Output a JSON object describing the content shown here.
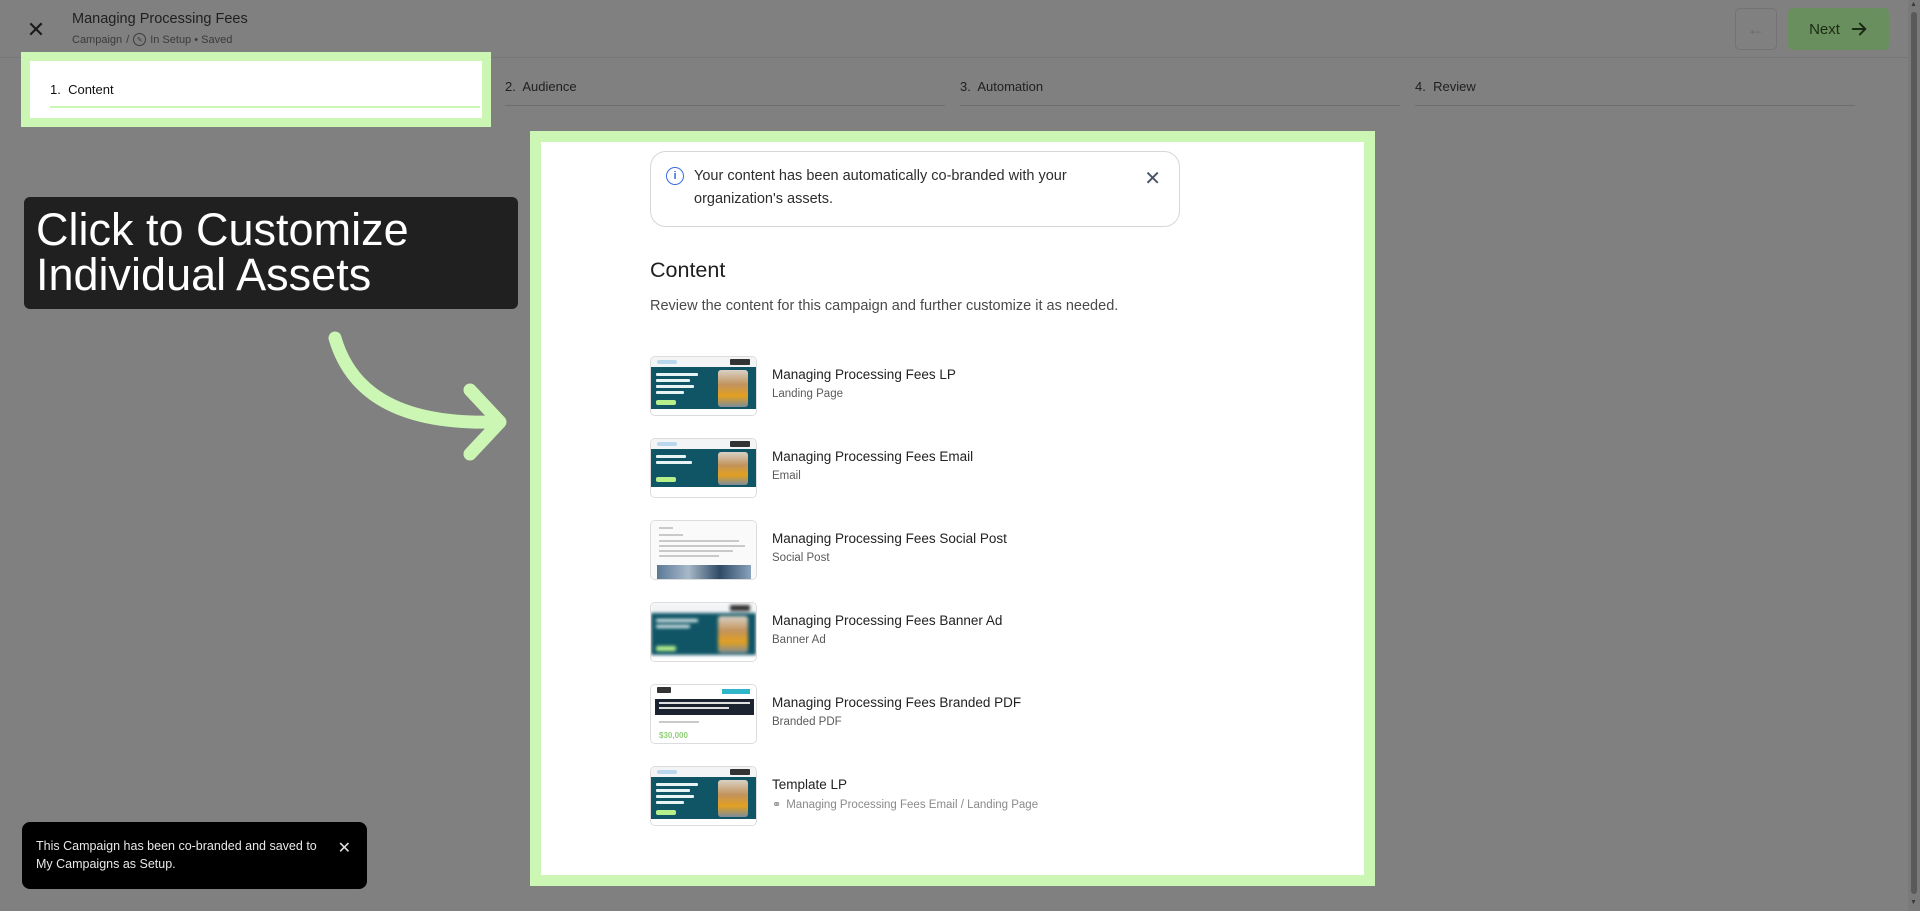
{
  "header": {
    "title": "Managing Processing Fees",
    "breadcrumb_parent": "Campaign",
    "breadcrumb_sep": "/",
    "status": "In Setup • Saved",
    "next_label": "Next"
  },
  "steps": [
    {
      "number": "1.",
      "label": "Content"
    },
    {
      "number": "2.",
      "label": "Audience"
    },
    {
      "number": "3.",
      "label": "Automation"
    },
    {
      "number": "4.",
      "label": "Review"
    }
  ],
  "callout": {
    "text": "Click to Customize\nIndividual Assets"
  },
  "info_banner": {
    "text": "Your content has been automatically co-branded with your organization's assets."
  },
  "content": {
    "heading": "Content",
    "subheading": "Review the content for this campaign and further customize it as needed."
  },
  "assets": [
    {
      "title": "Managing Processing Fees LP",
      "type": "Landing Page"
    },
    {
      "title": "Managing Processing Fees Email",
      "type": "Email"
    },
    {
      "title": "Managing Processing Fees Social Post",
      "type": "Social Post"
    },
    {
      "title": "Managing Processing Fees Banner Ad",
      "type": "Banner Ad"
    },
    {
      "title": "Managing Processing Fees Branded PDF",
      "type": "Branded PDF",
      "pdf_amount": "$30,000"
    },
    {
      "title": "Template LP",
      "type": "Managing Processing Fees Email / Landing Page"
    }
  ],
  "toast": {
    "text": "This Campaign has been co-branded and saved to My Campaigns as Setup."
  },
  "colors": {
    "highlight": "#ccf6b4",
    "next_button": "#6a8f5e",
    "info_icon": "#3b6ce6"
  }
}
